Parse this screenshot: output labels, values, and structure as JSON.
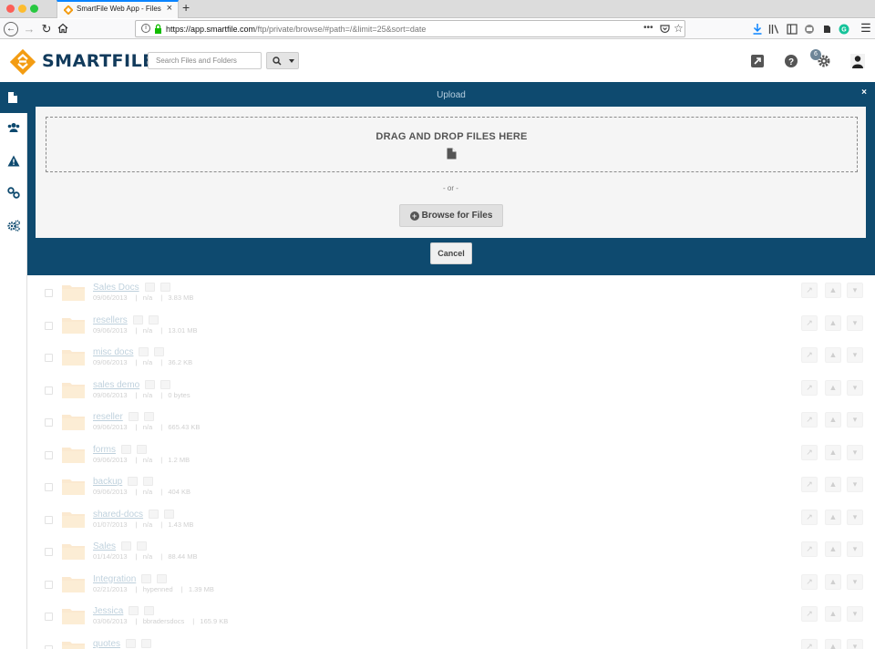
{
  "browser": {
    "tab_title": "SmartFile Web App - Files",
    "url_host": "https://app.smartfile.com",
    "url_path": "/ftp/private/browse/#path=/&limit=25&sort=date"
  },
  "header": {
    "logo_text": "SMARTFILE",
    "search_placeholder": "Search Files and Folders",
    "notification_count": "6"
  },
  "upload": {
    "title": "Upload",
    "close": "×",
    "drop_label": "DRAG AND DROP FILES HERE",
    "or_label": "- or -",
    "browse_label": "Browse for Files",
    "cancel_label": "Cancel"
  },
  "files": [
    {
      "name": "Sales Docs",
      "date": "09/06/2013",
      "owner": "n/a",
      "size": "3.83 MB"
    },
    {
      "name": "resellers",
      "date": "09/06/2013",
      "owner": "n/a",
      "size": "13.01 MB"
    },
    {
      "name": "misc docs",
      "date": "09/06/2013",
      "owner": "n/a",
      "size": "36.2 KB"
    },
    {
      "name": "sales demo",
      "date": "09/06/2013",
      "owner": "n/a",
      "size": "0 bytes"
    },
    {
      "name": "reseller",
      "date": "09/06/2013",
      "owner": "n/a",
      "size": "665.43 KB"
    },
    {
      "name": "forms",
      "date": "09/06/2013",
      "owner": "n/a",
      "size": "1.2 MB"
    },
    {
      "name": "backup",
      "date": "09/06/2013",
      "owner": "n/a",
      "size": "404 KB"
    },
    {
      "name": "shared-docs",
      "date": "01/07/2013",
      "owner": "n/a",
      "size": "1.43 MB"
    },
    {
      "name": "Sales",
      "date": "01/14/2013",
      "owner": "n/a",
      "size": "88.44 MB"
    },
    {
      "name": "Integration",
      "date": "02/21/2013",
      "owner": "hypenned",
      "size": "1.39 MB"
    },
    {
      "name": "Jessica",
      "date": "03/06/2013",
      "owner": "bbradersdocs",
      "size": "165.9 KB"
    },
    {
      "name": "quotes",
      "date": "",
      "owner": "",
      "size": ""
    }
  ],
  "colors": {
    "brand_navy": "#0e4a6f",
    "brand_orange": "#f39c12",
    "logo_text": "#123b5c"
  }
}
